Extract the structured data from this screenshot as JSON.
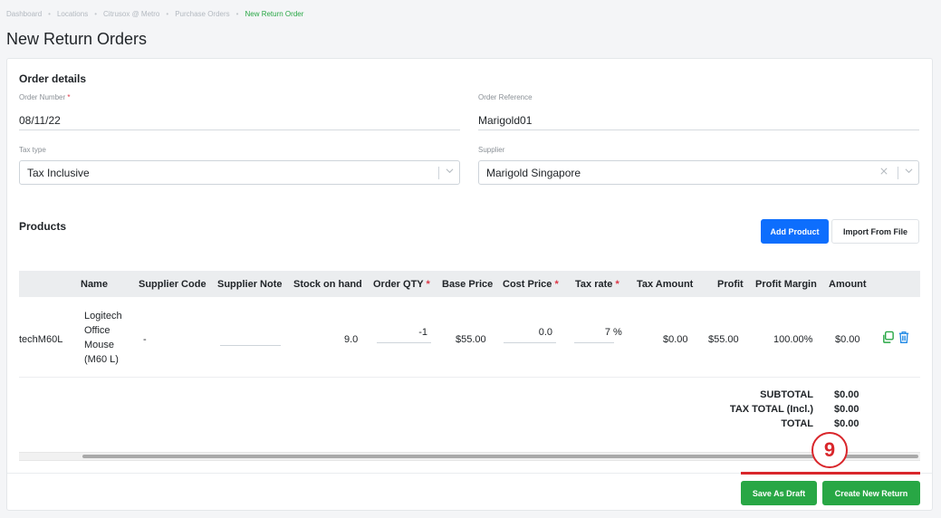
{
  "breadcrumb": {
    "items": [
      "Dashboard",
      "Locations",
      "Citrusox @ Metro",
      "Purchase Orders"
    ],
    "current": "New Return Order"
  },
  "page_title": "New Return Orders",
  "order_details": {
    "title": "Order details",
    "order_number_label": "Order Number",
    "order_number_value": "08/11/22",
    "order_reference_label": "Order Reference",
    "order_reference_value": "Marigold01",
    "tax_type_label": "Tax type",
    "tax_type_value": "Tax Inclusive",
    "supplier_label": "Supplier",
    "supplier_value": "Marigold Singapore"
  },
  "products": {
    "title": "Products",
    "add_product_label": "Add Product",
    "import_label": "Import From File",
    "columns": {
      "name": "Name",
      "supplier_code": "Supplier Code",
      "supplier_note": "Supplier Note",
      "stock_on_hand": "Stock on hand",
      "order_qty": "Order QTY",
      "base_price": "Base Price",
      "cost_price": "Cost Price",
      "tax_rate": "Tax rate",
      "tax_amount": "Tax Amount",
      "profit": "Profit",
      "profit_margin": "Profit Margin",
      "amount": "Amount"
    },
    "rows": [
      {
        "sku": "techM60L",
        "name_lines": [
          "Logitech",
          "Office",
          "Mouse",
          "(M60 L)"
        ],
        "supplier_code": "-",
        "supplier_note": "",
        "stock_on_hand": "9.0",
        "order_qty": "-1",
        "base_price": "$55.00",
        "cost_price": "0.0",
        "tax_rate": "7",
        "tax_unit": "%",
        "tax_amount": "$0.00",
        "profit": "$55.00",
        "profit_margin": "100.00%",
        "amount": "$0.00"
      }
    ]
  },
  "totals": {
    "subtotal_label": "SUBTOTAL",
    "subtotal_value": "$0.00",
    "tax_total_label": "TAX TOTAL (Incl.)",
    "tax_total_value": "$0.00",
    "total_label": "TOTAL",
    "total_value": "$0.00"
  },
  "actions": {
    "save_draft_label": "Save As Draft",
    "create_label": "Create New Return"
  },
  "annotation": {
    "step_number": "9"
  },
  "colors": {
    "primary": "#0d6efd",
    "success": "#28a745",
    "required": "#dc3545",
    "annotation": "#d9262b",
    "icon_green": "#28a745",
    "icon_blue": "#1e88e5"
  },
  "icons": {
    "copy": "copy-icon",
    "delete": "trash-icon",
    "chevron": "chevron-down-icon",
    "clear": "clear-icon"
  }
}
